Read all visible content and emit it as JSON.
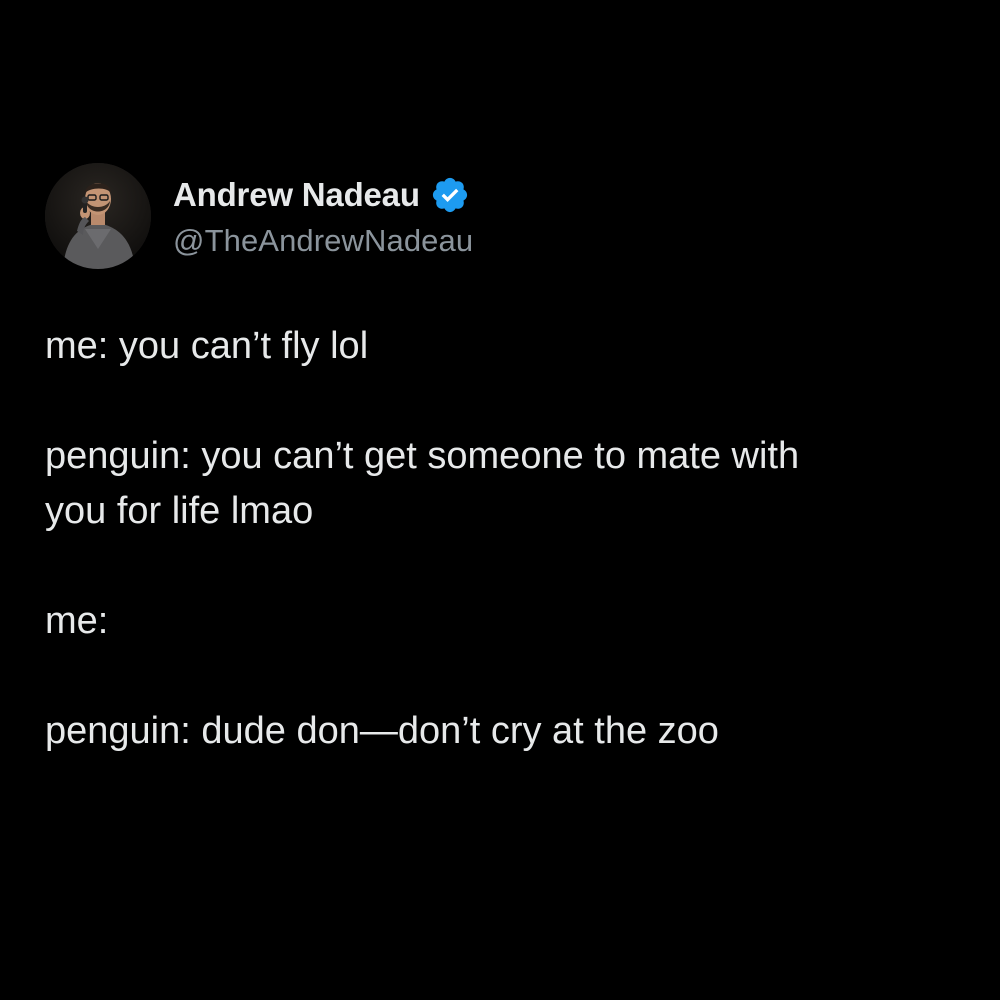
{
  "tweet": {
    "author": {
      "display_name": "Andrew Nadeau",
      "handle": "@TheAndrewNadeau",
      "verified": true,
      "avatar": "avatar-photo",
      "verified_icon": "verified-badge-icon"
    },
    "paragraphs": [
      {
        "lines": [
          "me: you can’t fly lol"
        ]
      },
      {
        "lines": [
          "penguin: you can’t get someone to mate with",
          "you for life lmao"
        ]
      },
      {
        "lines": [
          "me:"
        ]
      },
      {
        "lines": [
          "penguin: dude don—don’t cry at the zoo"
        ]
      }
    ]
  },
  "colors": {
    "background": "#000000",
    "text": "#e7e9ea",
    "handle": "#8b949c",
    "verified_badge": "#1d9bf0"
  }
}
